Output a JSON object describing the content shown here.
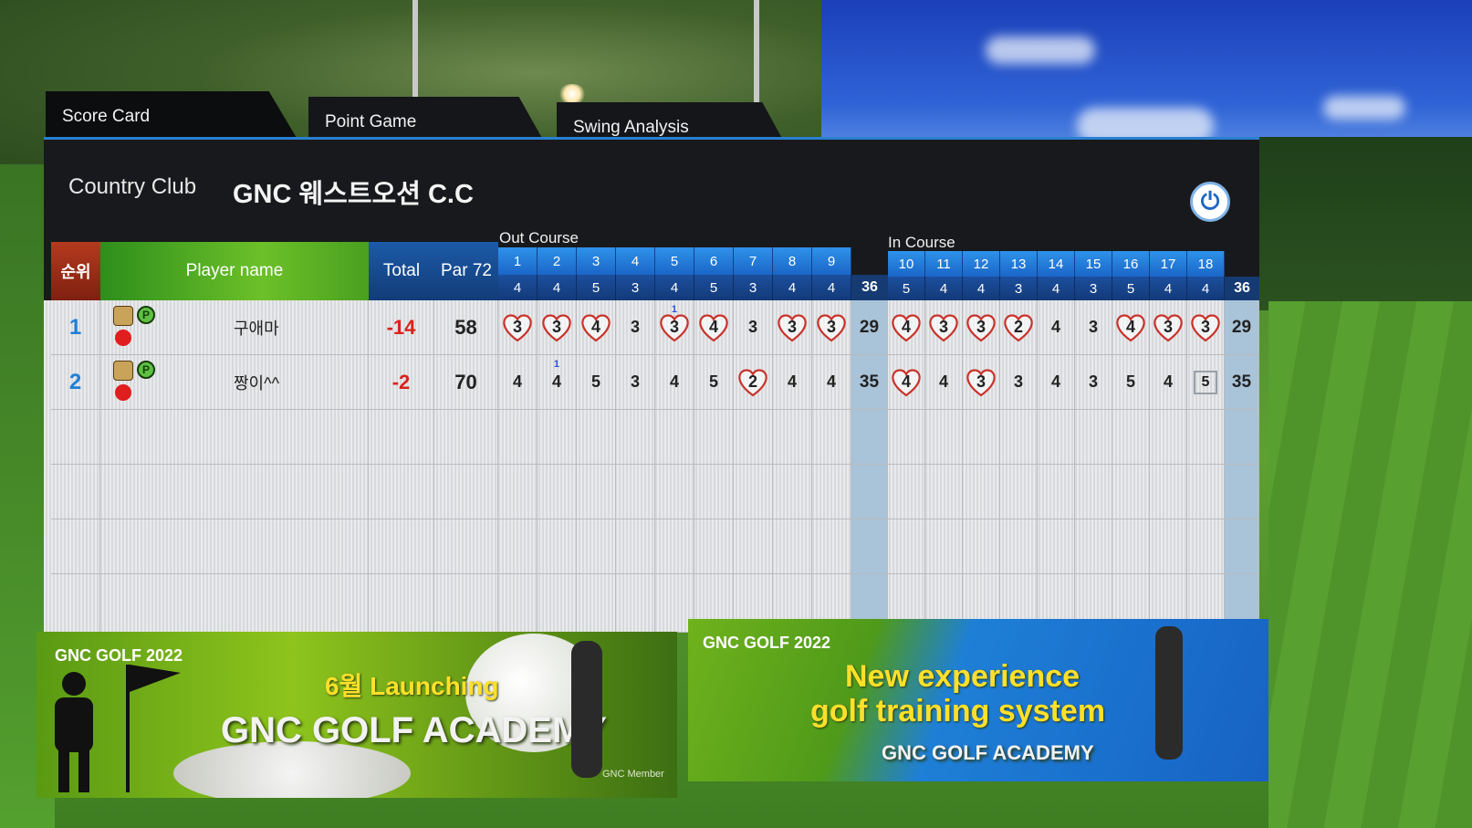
{
  "tabs": [
    {
      "label": "Score Card"
    },
    {
      "label": "Point Game"
    },
    {
      "label": "Swing Analysis"
    }
  ],
  "header": {
    "club_label": "Country Club",
    "club_name": "GNC 웨스트오션 C.C"
  },
  "course_labels": {
    "out": "Out Course",
    "in": "In Course"
  },
  "columns": {
    "rank": "순위",
    "player": "Player name",
    "total": "Total",
    "par": "Par 72"
  },
  "holes": {
    "out": [
      {
        "n": "1",
        "par": "4"
      },
      {
        "n": "2",
        "par": "4"
      },
      {
        "n": "3",
        "par": "5"
      },
      {
        "n": "4",
        "par": "3"
      },
      {
        "n": "5",
        "par": "4"
      },
      {
        "n": "6",
        "par": "5"
      },
      {
        "n": "7",
        "par": "3"
      },
      {
        "n": "8",
        "par": "4"
      },
      {
        "n": "9",
        "par": "4"
      }
    ],
    "out_total": "36",
    "in": [
      {
        "n": "10",
        "par": "5"
      },
      {
        "n": "11",
        "par": "4"
      },
      {
        "n": "12",
        "par": "4"
      },
      {
        "n": "13",
        "par": "3"
      },
      {
        "n": "14",
        "par": "4"
      },
      {
        "n": "15",
        "par": "3"
      },
      {
        "n": "16",
        "par": "5"
      },
      {
        "n": "17",
        "par": "4"
      },
      {
        "n": "18",
        "par": "4"
      }
    ],
    "in_total": "36"
  },
  "players": [
    {
      "rank": "1",
      "name": "구애마",
      "total": "-14",
      "strokes": "58",
      "out": [
        {
          "s": "3",
          "h": true
        },
        {
          "s": "3",
          "h": true
        },
        {
          "s": "4",
          "h": true
        },
        {
          "s": "3"
        },
        {
          "s": "3",
          "h": true,
          "p": "1"
        },
        {
          "s": "4",
          "h": true
        },
        {
          "s": "3"
        },
        {
          "s": "3",
          "h": true
        },
        {
          "s": "3",
          "h": true
        }
      ],
      "out_sum": "29",
      "in": [
        {
          "s": "4",
          "h": true
        },
        {
          "s": "3",
          "h": true
        },
        {
          "s": "3",
          "h": true
        },
        {
          "s": "2",
          "h": true
        },
        {
          "s": "4"
        },
        {
          "s": "3"
        },
        {
          "s": "4",
          "h": true
        },
        {
          "s": "3",
          "h": true
        },
        {
          "s": "3",
          "h": true
        }
      ],
      "in_sum": "29"
    },
    {
      "rank": "2",
      "name": "짱이^^",
      "total": "-2",
      "strokes": "70",
      "out": [
        {
          "s": "4"
        },
        {
          "s": "4",
          "p": "1"
        },
        {
          "s": "5"
        },
        {
          "s": "3"
        },
        {
          "s": "4"
        },
        {
          "s": "5"
        },
        {
          "s": "2",
          "h": true
        },
        {
          "s": "4"
        },
        {
          "s": "4"
        }
      ],
      "out_sum": "35",
      "in": [
        {
          "s": "4",
          "h": true
        },
        {
          "s": "4"
        },
        {
          "s": "3",
          "h": true
        },
        {
          "s": "3"
        },
        {
          "s": "4"
        },
        {
          "s": "3"
        },
        {
          "s": "5"
        },
        {
          "s": "4"
        },
        {
          "s": "5",
          "b": true
        }
      ],
      "in_sum": "35"
    }
  ],
  "banners": {
    "left": {
      "tag": "GNC GOLF 2022",
      "line1": "6월 Launching",
      "line2": "GNC GOLF ACADEMY",
      "small": "GNC Member"
    },
    "right": {
      "tag": "GNC GOLF 2022",
      "line1": "New experience",
      "line2": "golf training system",
      "line3": "GNC GOLF ACADEMY"
    }
  },
  "colors": {
    "accent_blue": "#1a66c8",
    "rank_red": "#b53a1e",
    "name_green": "#4aa020",
    "under_par_red": "#d8231c"
  }
}
